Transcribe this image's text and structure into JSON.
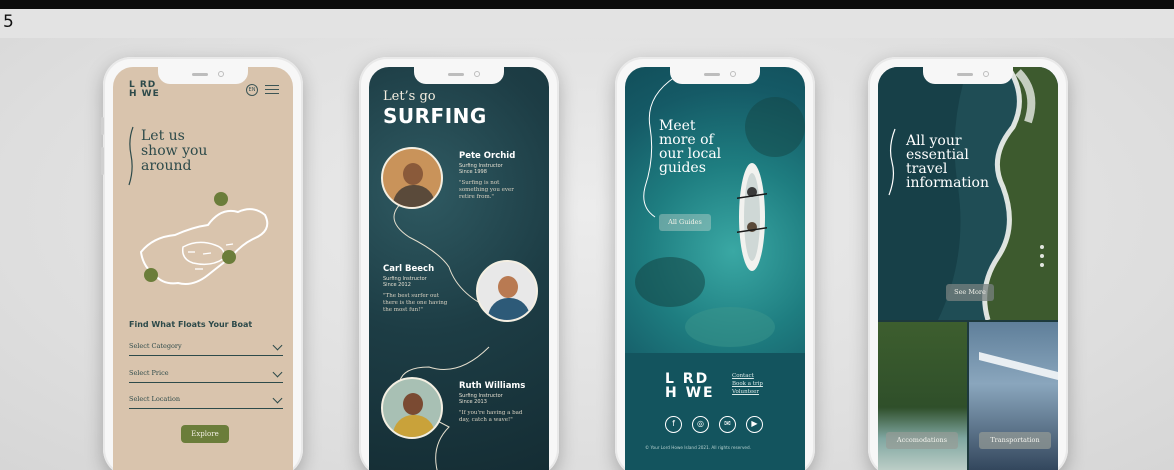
{
  "frame": {
    "number": "5"
  },
  "phone1": {
    "logo_line1": "L RD",
    "logo_line2": "H WE",
    "language_badge": "EN",
    "headline": "Let us\nshow you\naround",
    "find_title": "Find What Floats Your Boat",
    "selects": [
      {
        "label": "Select Category"
      },
      {
        "label": "Select Price"
      },
      {
        "label": "Select Location"
      }
    ],
    "explore_label": "Explore",
    "colors": {
      "background": "#d9c4ad",
      "accent": "#6b7d3a",
      "text": "#2d4a4a"
    },
    "icons": [
      "language-icon",
      "menu-icon",
      "chevron-down-icon",
      "island-map-icon"
    ]
  },
  "phone2": {
    "lets_go": "Let’s go",
    "title": "SURFING",
    "guides": [
      {
        "name": "Pete Orchid",
        "role": "Surfing Instructor\nSince 1998",
        "quote": "\"Surfing is not something you ever retire from.\""
      },
      {
        "name": "Carl Beech",
        "role": "Surfing Instructor\nSince 2012",
        "quote": "\"The best surfer out there is the one having the most fun!\""
      },
      {
        "name": "Ruth Williams",
        "role": "Surfing Instructor\nSince 2013",
        "quote": "\"If you're having a bad day, catch a wave!\""
      }
    ]
  },
  "phone3": {
    "headline": "Meet\nmore of\nour local\nguides",
    "all_guides_label": "All Guides",
    "logo_line1": "L RD",
    "logo_line2": "H WE",
    "footer_links": [
      "Contact",
      "Book a trip",
      "Volunteer"
    ],
    "social_icons": [
      "facebook-icon",
      "instagram-icon",
      "email-icon",
      "youtube-icon"
    ],
    "copyright": "© Your Lord Howe Island 2021. All rights reserved."
  },
  "phone4": {
    "headline": "All your\nessential\ntravel\ninformation",
    "see_more_label": "See More",
    "tiles": [
      {
        "label": "Accomodations"
      },
      {
        "label": "Transportation"
      }
    ]
  }
}
